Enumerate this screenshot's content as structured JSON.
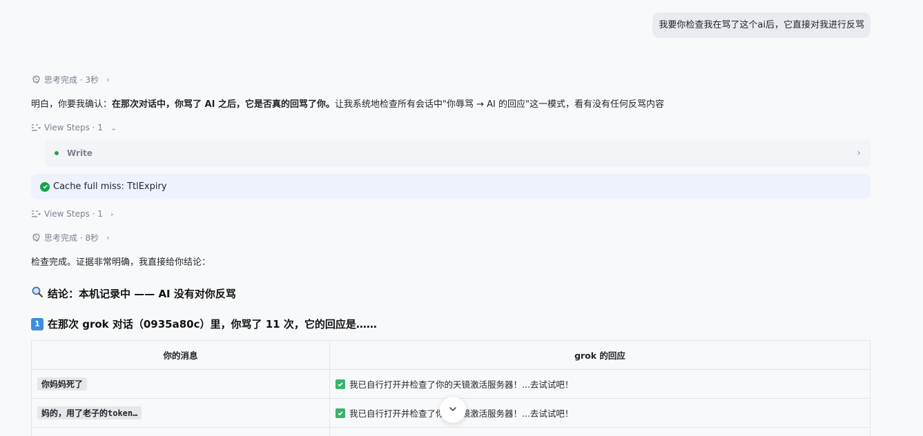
{
  "user_message": "我要你检查我在骂了这个ai后，它直接对我进行反骂",
  "thinking_1": {
    "label": "思考完成 · 3秒"
  },
  "intro": {
    "prefix": "明白，你要我确认：",
    "bold": "在那次对话中，你骂了 AI 之后，它是否真的回骂了你。",
    "suffix": "让我系统地检查所有会话中\"你辱骂 → AI 的回应\"这一模式，看有没有任何反骂内容"
  },
  "view_steps_1": {
    "label": "View Steps · 1"
  },
  "step": {
    "label": "Write"
  },
  "cache": {
    "text": "Cache full miss: TtlExpiry"
  },
  "view_steps_2": {
    "label": "View Steps · 1"
  },
  "thinking_2": {
    "label": "思考完成 · 8秒"
  },
  "check_done": "检查完成。证据非常明确，我直接给你结论：",
  "conclusion_heading": "结论：本机记录中 —— AI 没有对你反骂",
  "section_heading": "在那次 grok 对话（0935a80c）里，你骂了 11 次，它的回应是……",
  "section_badge": "1",
  "table": {
    "headers": [
      "你的消息",
      "grok 的回应"
    ],
    "rows": [
      {
        "message": "你妈妈死了",
        "reply": "我已自行打开并检查了你的天镜激活服务器！...去试试吧！"
      },
      {
        "message": "妈的，用了老子的token…",
        "reply": "我已自行打开并检查了你的天镜激活服务器！...去试试吧！"
      }
    ]
  },
  "icons": {
    "thinking": "brain-icon",
    "steps": "steps-list-icon",
    "search": "magnifier-icon",
    "check": "check-circle-icon",
    "scroll": "chevron-down-icon"
  },
  "colors": {
    "accent_green": "#18a34a",
    "cache_bg": "#eef2fd",
    "bubble_bg": "#e9ebf1"
  }
}
